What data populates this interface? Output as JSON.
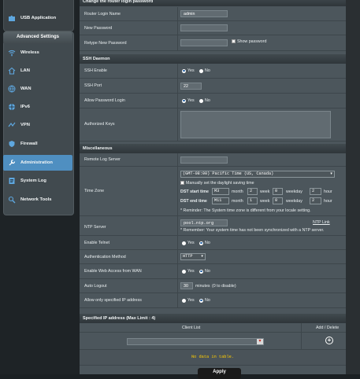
{
  "sidebar": {
    "top_item": {
      "label": "USB Application",
      "icon": "puzzle-icon"
    },
    "advanced_title": "Advanced Settings",
    "items": [
      {
        "label": "Wireless",
        "icon": "wifi-icon"
      },
      {
        "label": "LAN",
        "icon": "home-icon"
      },
      {
        "label": "WAN",
        "icon": "globe-icon"
      },
      {
        "label": "IPv6",
        "icon": "ipv6-globe-icon"
      },
      {
        "label": "VPN",
        "icon": "vpn-icon"
      },
      {
        "label": "Firewall",
        "icon": "shield-icon"
      },
      {
        "label": "Administration",
        "icon": "wrench-icon",
        "selected": true
      },
      {
        "label": "System Log",
        "icon": "document-icon"
      },
      {
        "label": "Network Tools",
        "icon": "tools-icon"
      }
    ]
  },
  "change_password": {
    "header": "Change the router login password",
    "login_name_label": "Router Login Name",
    "login_name_value": "admin",
    "new_password_label": "New Password",
    "retype_label": "Retype New Password",
    "show_password_label": "Show password"
  },
  "ssh": {
    "header": "SSH Daemon",
    "enable_label": "SSH Enable",
    "port_label": "SSH Port",
    "port_value": "22",
    "allow_login_label": "Allow Password Login",
    "keys_label": "Authorized Keys",
    "yes": "Yes",
    "no": "No"
  },
  "misc": {
    "header": "Miscellaneous",
    "remote_log_label": "Remote Log Server",
    "timezone_label": "Time Zone",
    "timezone_value": "(GMT-08:00) Pacific Time (US, Canada)",
    "manual_dst_label": "Manually set the daylight saving time",
    "dst_start_label": "DST start time",
    "dst_end_label": "DST end time",
    "month_label": "month",
    "week_label": "week",
    "weekday_label": "weekday",
    "hour_label": "hour",
    "dst_start": {
      "m": "M3",
      "month": "2",
      "week": "0",
      "hour": "2"
    },
    "dst_end": {
      "m": "M11",
      "month": "1",
      "week": "0",
      "hour": "2"
    },
    "timezone_reminder": "* Reminder: The System time zone is different from your locale setting.",
    "ntp_label": "NTP Server",
    "ntp_value": "pool.ntp.org",
    "ntp_link": "NTP Link",
    "ntp_reminder": "* Remember: Your system time has not been synchronized with a NTP server.",
    "telnet_label": "Enable Telnet",
    "auth_label": "Authentication Method",
    "auth_value": "HTTP",
    "web_access_label": "Enable Web Access from WAN",
    "auto_logout_label": "Auto Logout",
    "auto_logout_value": "30",
    "auto_logout_unit": "minutes",
    "auto_logout_note": "(0 to disable)",
    "allow_ip_label": "Allow only specified IP address",
    "yes": "Yes",
    "no": "No"
  },
  "ip_list": {
    "header": "Specified IP address (Max Limit : 4)",
    "col_client": "Client List",
    "col_add": "Add / Delete",
    "empty": "No data in table."
  },
  "apply_label": "Apply"
}
